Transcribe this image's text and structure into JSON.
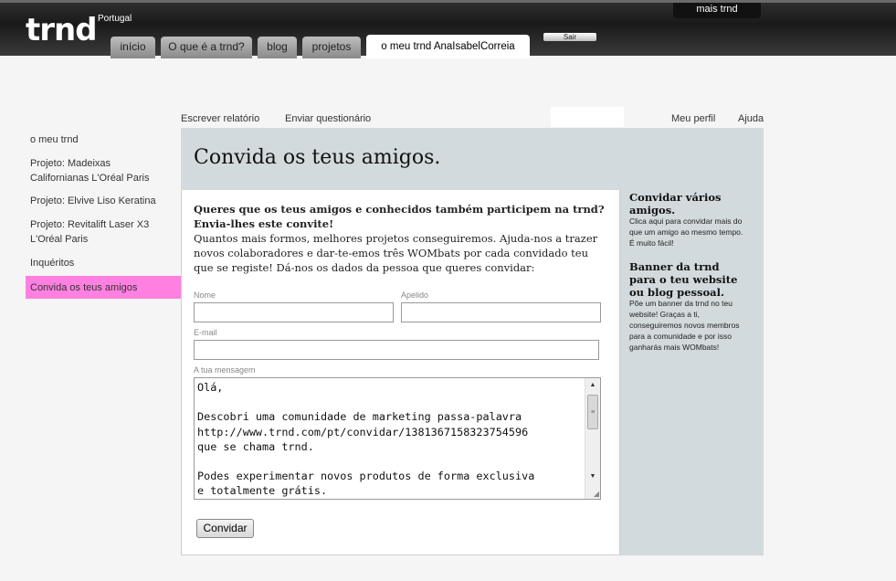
{
  "header": {
    "logo": "trnd",
    "country": "Portugal",
    "mais_trnd": "mais trnd",
    "sair": "Sair",
    "tabs": [
      {
        "label": "início"
      },
      {
        "label": "O que é a trnd?"
      },
      {
        "label": "blog"
      },
      {
        "label": "projetos"
      },
      {
        "label": "o meu trnd AnaIsabelCorreia"
      }
    ]
  },
  "subnav": {
    "escrever": "Escrever relatório",
    "enviar": "Enviar questionário",
    "perfil": "Meu perfil",
    "ajuda": "Ajuda"
  },
  "sidebar": {
    "items": [
      {
        "label": "o meu trnd"
      },
      {
        "label": "Projeto: Madeixas Californianas L'Oréal Paris"
      },
      {
        "label": "Projeto: Elvive Liso Keratina"
      },
      {
        "label": "Projeto: Revitalift Laser X3 L'Oréal Paris"
      },
      {
        "label": "Inquéritos"
      },
      {
        "label": "Convida os teus amigos"
      }
    ]
  },
  "main": {
    "title": "Convida os teus amigos.",
    "intro_bold": "Queres que os teus amigos e conhecidos também participem na trnd? Envia-lhes este convite!",
    "intro_text": "Quantos mais formos, melhores projetos conseguiremos. Ajuda-nos a trazer novos colaboradores e dar-te-emos três WOMbats por cada convidado teu que se registe! Dá-nos os dados da pessoa que queres convidar:",
    "form": {
      "nome_label": "Nome",
      "apelido_label": "Apelido",
      "email_label": "E-mail",
      "mensagem_label": "A tua mensagem",
      "mensagem_value": "Olá,\n\nDescobri uma comunidade de marketing passa-palavra\nhttp://www.trnd.com/pt/convidar/1381367158323754596\nque se chama trnd.\n\nPodes experimentar novos produtos de forma exclusiva\ne totalmente grátis.",
      "submit": "Convidar"
    }
  },
  "right": {
    "h1": "Convidar vários amigos.",
    "t1": "Clica aqui para convidar mais do que um amigo ao mesmo tempo. É muito fácil!",
    "h2": "Banner da trnd para o teu website ou blog pessoal.",
    "t2": "Põe um banner da trnd no teu website! Graças a ti, conseguiremos novos membros para a comunidade e por isso ganharás mais WOMbats!"
  },
  "colors": {
    "header_bg": "#1e1e1e",
    "active_sidebar": "#ff80e0",
    "panel_bg": "#d2dadd"
  }
}
